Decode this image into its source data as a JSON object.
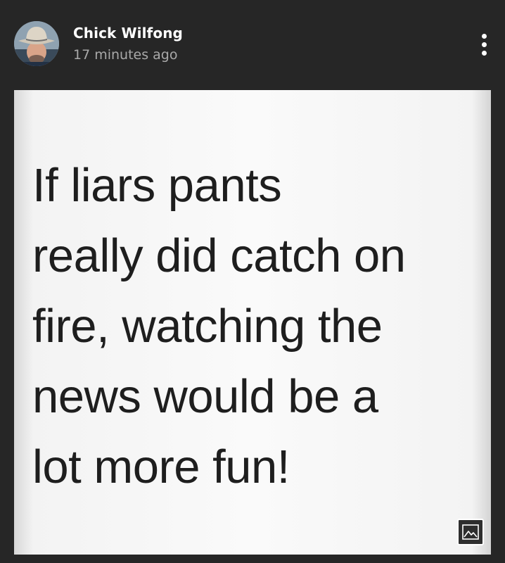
{
  "post": {
    "author_name": "Chick Wilfong",
    "timestamp": "17 minutes ago",
    "image_text": "If liars pants\nreally did catch on\nfire, watching the\nnews would be a\nlot more fun!"
  },
  "icons": {
    "menu": "more-vertical-icon",
    "image_badge": "image-icon"
  },
  "colors": {
    "background": "#262626",
    "author": "#ffffff",
    "timestamp": "#a9a9a9",
    "image_background": "#fafafa",
    "image_text": "#1e1e1e"
  }
}
